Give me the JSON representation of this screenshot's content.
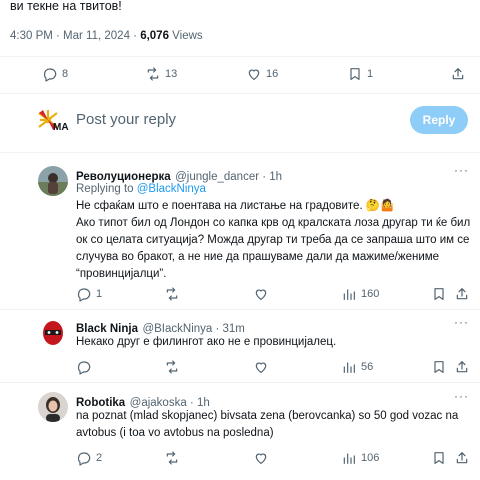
{
  "main_tweet": {
    "text_tail": "ви текне на твитов!",
    "time": "4:30 PM · Mar 11, 2024 ·",
    "views_count": "6,076",
    "views_label": "Views",
    "stats": {
      "replies": "8",
      "retweets": "13",
      "likes": "16",
      "bookmarks": "1"
    }
  },
  "reply_box": {
    "placeholder": "Post your reply",
    "button": "Reply"
  },
  "replies": [
    {
      "name": "Револуционерка",
      "handle": "@jungle_dancer · 1h",
      "replying_to_prefix": "Replying to",
      "replying_to": "@BlackNinya",
      "lines": [
        "Не сфаќам што е поентава на листање на градовите. 🤔🤷",
        "Ако типот бил од Лондон со капка крв од кралската лоза другар ти ќе бил",
        "ок со целата ситуација? Можда другар ти треба да се запраша што им се",
        "случува во бракот, а не ние да прашуваме дали да мажиме/жениме",
        "“провинцијалци”."
      ],
      "stats": {
        "replies": "1",
        "retweets": "",
        "likes": "",
        "views": "160"
      }
    },
    {
      "name": "Black Ninja",
      "handle": "@BIackNinya · 31m",
      "lines": [
        "Некако друг е филингот ако не е провинцијалец."
      ],
      "stats": {
        "replies": "",
        "retweets": "",
        "likes": "",
        "views": "56"
      }
    },
    {
      "name": "Robotika",
      "handle": "@ajakoska · 1h",
      "lines": [
        "na poznat (mlad skopjanec) bivsata zena (berovcanka) so 50 god vozac na",
        "avtobus (i toa vo avtobus na posledna)"
      ],
      "stats": {
        "replies": "2",
        "retweets": "",
        "likes": "",
        "views": "106"
      }
    }
  ],
  "colors": {
    "accent": "#1d9bf0",
    "reply_button": "#8ecdf8",
    "text": "#0f1419",
    "muted": "#536471"
  },
  "icons": [
    "comment-icon",
    "retweet-icon",
    "heart-icon",
    "bookmark-icon",
    "share-icon",
    "views-icon",
    "more-icon"
  ]
}
